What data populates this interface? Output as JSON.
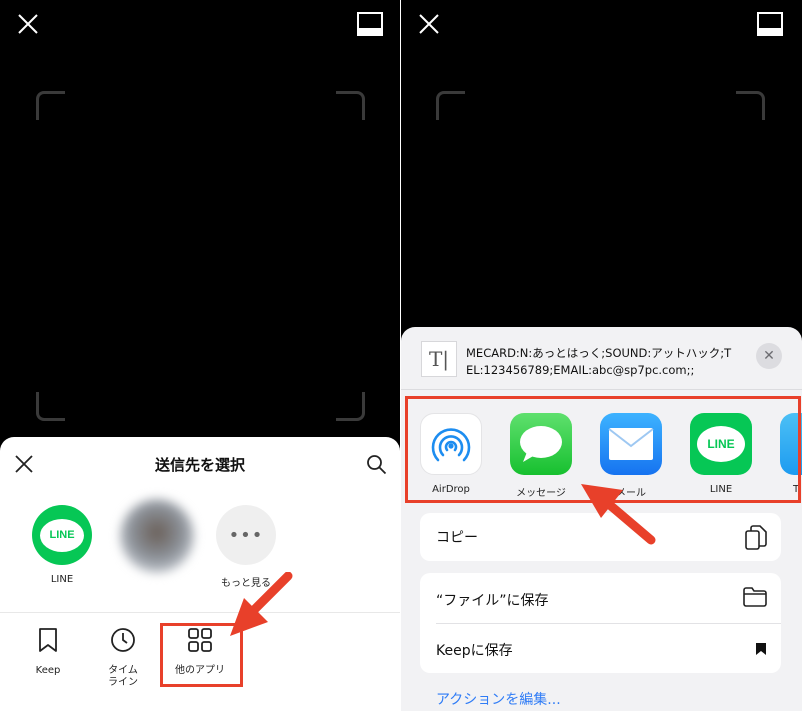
{
  "left": {
    "share_title": "送信先を選択",
    "friends": [
      {
        "label": "LINE",
        "logo_text": "LINE"
      },
      {
        "label": ""
      },
      {
        "label": "もっと見る",
        "icon": "more-dots"
      }
    ],
    "options": [
      {
        "label": "Keep",
        "icon": "bookmark-icon"
      },
      {
        "label": "タイム\nライン",
        "icon": "clock-icon"
      },
      {
        "label": "他のアプリ",
        "icon": "grid-icon"
      }
    ]
  },
  "right": {
    "shared_text": "MECARD:N:あっとはっく;SOUND:アットハック;TEL:123456789;EMAIL:abc@sp7pc.com;;",
    "apps": [
      {
        "label": "AirDrop",
        "icon": "airdrop-icon"
      },
      {
        "label": "メッセージ",
        "icon": "messages-icon"
      },
      {
        "label": "メール",
        "icon": "mail-icon"
      },
      {
        "label": "LINE",
        "icon": "line-icon",
        "logo_text": "LINE"
      },
      {
        "label": "T",
        "icon": "twitter-icon"
      }
    ],
    "actions": [
      {
        "label": "コピー",
        "icon": "copy-icon"
      },
      {
        "label": "“ファイル”に保存",
        "icon": "folder-icon"
      },
      {
        "label": "Keepに保存",
        "icon": "bookmark-filled-icon"
      }
    ],
    "edit_actions": "アクションを編集..."
  },
  "colors": {
    "line_green": "#06c755",
    "highlight_red": "#e8402a",
    "link_blue": "#2f7cf6"
  }
}
